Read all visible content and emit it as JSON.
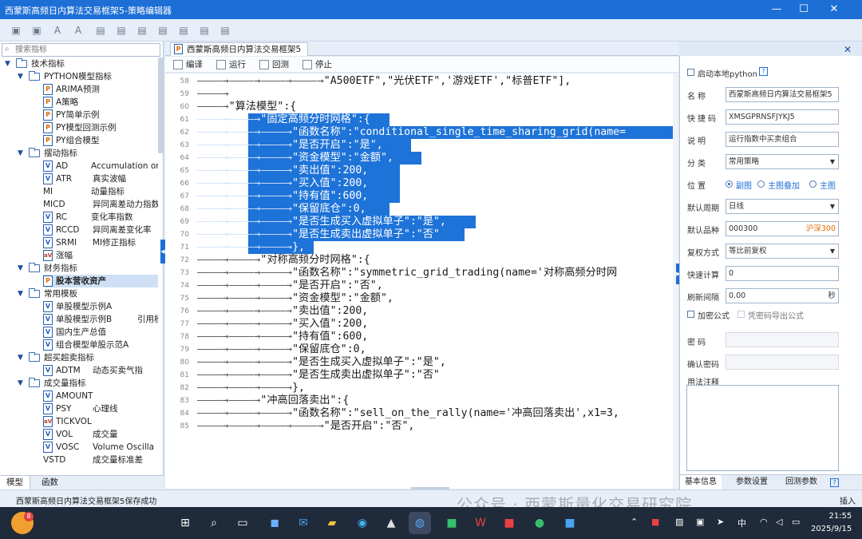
{
  "window": {
    "title": "西蒙斯高频日内算法交易框架5-策略编辑器",
    "minimize": "—",
    "maximize": "☐",
    "close": "✕"
  },
  "left": {
    "search_placeholder": "搜索指标",
    "tree": [
      {
        "kind": "folder",
        "level": 0,
        "label": "技术指标"
      },
      {
        "kind": "folder",
        "level": 1,
        "label": "PYTHON模型指标"
      },
      {
        "kind": "leaf",
        "icon": "p",
        "name": "ARIMA预测",
        "desc": ""
      },
      {
        "kind": "leaf",
        "icon": "p",
        "name": "A策略",
        "desc": ""
      },
      {
        "kind": "leaf",
        "icon": "p",
        "name": "PY简单示例",
        "desc": ""
      },
      {
        "kind": "leaf",
        "icon": "p",
        "name": "PY模型回测示例",
        "desc": ""
      },
      {
        "kind": "leaf",
        "icon": "p",
        "name": "PY组合模型",
        "desc": ""
      },
      {
        "kind": "folder",
        "level": 1,
        "label": "摆动指标"
      },
      {
        "kind": "leaf",
        "icon": "v",
        "name": "AD",
        "desc": "Accumulation or"
      },
      {
        "kind": "leaf",
        "icon": "v",
        "name": "ATR",
        "desc": "真实波幅"
      },
      {
        "kind": "leaf",
        "icon": "",
        "name": "MI",
        "desc": "动量指标"
      },
      {
        "kind": "leaf",
        "icon": "",
        "name": "MICD",
        "desc": "异同离差动力指数"
      },
      {
        "kind": "leaf",
        "icon": "v",
        "name": "RC",
        "desc": "变化率指数"
      },
      {
        "kind": "leaf",
        "icon": "v",
        "name": "RCCD",
        "desc": "异同离差变化率"
      },
      {
        "kind": "leaf",
        "icon": "v",
        "name": "SRMI",
        "desc": "MI修正指标"
      },
      {
        "kind": "leaf",
        "icon": "av",
        "name": "涨幅",
        "desc": ""
      },
      {
        "kind": "folder",
        "level": 1,
        "label": "财务指标"
      },
      {
        "kind": "leaf",
        "icon": "p",
        "name": "股本营收资产",
        "desc": "",
        "selected": true
      },
      {
        "kind": "folder",
        "level": 1,
        "label": "常用模板"
      },
      {
        "kind": "leaf",
        "icon": "v",
        "name": "单股模型示例A",
        "desc": ""
      },
      {
        "kind": "leaf",
        "icon": "v",
        "name": "单股模型示例B",
        "desc": "引用模"
      },
      {
        "kind": "leaf",
        "icon": "v",
        "name": "国内生产总值",
        "desc": ""
      },
      {
        "kind": "leaf",
        "icon": "v",
        "name": "组合模型单股示范A",
        "desc": ""
      },
      {
        "kind": "folder",
        "level": 1,
        "label": "超买超卖指标"
      },
      {
        "kind": "leaf",
        "icon": "v",
        "name": "ADTM",
        "desc": "动态买卖气指"
      },
      {
        "kind": "folder",
        "level": 1,
        "label": "成交量指标"
      },
      {
        "kind": "leaf",
        "icon": "v",
        "name": "AMOUNT",
        "desc": ""
      },
      {
        "kind": "leaf",
        "icon": "v",
        "name": "PSY",
        "desc": "心理线"
      },
      {
        "kind": "leaf",
        "icon": "av",
        "name": "TICKVOL",
        "desc": ""
      },
      {
        "kind": "leaf",
        "icon": "v",
        "name": "VOL",
        "desc": "成交量"
      },
      {
        "kind": "leaf",
        "icon": "v",
        "name": "VOSC",
        "desc": "Volume Oscilla"
      },
      {
        "kind": "leaf",
        "icon": "",
        "name": "VSTD",
        "desc": "成交量标准差"
      }
    ],
    "tabs": [
      "模型",
      "函数"
    ]
  },
  "editor": {
    "tab_title": "西蒙斯高频日内算法交易框架5",
    "toolbar": [
      "编译",
      "运行",
      "回测",
      "停止"
    ],
    "lines": [
      {
        "n": "58",
        "indent": "————→————→————→————→",
        "text": "\"A500ETF\",\"光伏ETF\",'游戏ETF',\"标普ETF\"],",
        "sel": false
      },
      {
        "n": "59",
        "indent": "————→",
        "text": "",
        "sel": false
      },
      {
        "n": "60",
        "indent": "————→",
        "text": "\"算法模型\":{",
        "sel": false
      },
      {
        "n": "61",
        "indent": "————→————→",
        "text": "\"固定高频分时网格\":{",
        "sel": true
      },
      {
        "n": "62",
        "indent": "————→————→————→",
        "text": "\"函数名称\":\"conditional_single_time_sharing_grid(name=",
        "sel": true
      },
      {
        "n": "63",
        "indent": "————→————→————→",
        "text": "\"是否开启\":\"是\",",
        "sel": true
      },
      {
        "n": "64",
        "indent": "————→————→————→",
        "text": "\"资金模型\":\"金额\",",
        "sel": true
      },
      {
        "n": "65",
        "indent": "————→————→————→",
        "text": "\"卖出值\":200,",
        "sel": true
      },
      {
        "n": "66",
        "indent": "————→————→————→",
        "text": "\"买入值\":200,",
        "sel": true
      },
      {
        "n": "67",
        "indent": "————→————→————→",
        "text": "\"持有值\":600,",
        "sel": true
      },
      {
        "n": "68",
        "indent": "————→————→————→",
        "text": "\"保留底仓\":0,",
        "sel": true
      },
      {
        "n": "69",
        "indent": "————→————→————→",
        "text": "\"是否生成买入虚拟单子\":\"是\",",
        "sel": true
      },
      {
        "n": "70",
        "indent": "————→————→————→",
        "text": "\"是否生成卖出虚拟单子\":\"否\"",
        "sel": true
      },
      {
        "n": "71",
        "indent": "————→————→————→",
        "text": "},",
        "sel": true
      },
      {
        "n": "72",
        "indent": "————→————→",
        "text": "\"对称高频分时网格\":{",
        "sel": false
      },
      {
        "n": "73",
        "indent": "————→————→————→",
        "text": "\"函数名称\":\"symmetric_grid_trading(name='对称高频分时网",
        "sel": false
      },
      {
        "n": "74",
        "indent": "————→————→————→",
        "text": "\"是否开启\":\"否\",",
        "sel": false
      },
      {
        "n": "75",
        "indent": "————→————→————→",
        "text": "\"资金模型\":\"金额\",",
        "sel": false
      },
      {
        "n": "76",
        "indent": "————→————→————→",
        "text": "\"卖出值\":200,",
        "sel": false
      },
      {
        "n": "77",
        "indent": "————→————→————→",
        "text": "\"买入值\":200,",
        "sel": false
      },
      {
        "n": "78",
        "indent": "————→————→————→",
        "text": "\"持有值\":600,",
        "sel": false
      },
      {
        "n": "79",
        "indent": "————→————→————→",
        "text": "\"保留底仓\":0,",
        "sel": false
      },
      {
        "n": "80",
        "indent": "————→————→————→",
        "text": "\"是否生成买入虚拟单子\":\"是\",",
        "sel": false
      },
      {
        "n": "81",
        "indent": "————→————→————→",
        "text": "\"是否生成卖出虚拟单子\":\"否\"",
        "sel": false
      },
      {
        "n": "82",
        "indent": "————→————→————→",
        "text": "},",
        "sel": false
      },
      {
        "n": "83",
        "indent": "————→————→",
        "text": "\"冲高回落卖出\":{",
        "sel": false
      },
      {
        "n": "84",
        "indent": "————→————→————→",
        "text": "\"函数名称\":\"sell_on_the_rally(name='冲高回落卖出',x1=3,",
        "sel": false
      },
      {
        "n": "85",
        "indent": "————→————→————→————→",
        "text": "\"是否开启\":\"否\",",
        "sel": false
      }
    ]
  },
  "right": {
    "enable_local_python": "启动本地python",
    "help": "?",
    "name_label": "名称",
    "name_value": "西蒙斯高频日内算法交易框架5",
    "code_label": "快捷码",
    "code_value": "XMSGPRNSFJYKJ5",
    "desc_label": "说明",
    "desc_value": "运行指数中买卖组合",
    "category_label": "分类",
    "category_value": "常用策略",
    "position_label": "位置",
    "position_options": [
      "副图",
      "主图叠加",
      "主图"
    ],
    "period_label": "默认周期",
    "period_value": "日线",
    "symbol_label": "默认品种",
    "symbol_value": "000300",
    "symbol_hint": "沪深300",
    "adjust_label": "复权方式",
    "adjust_value": "等比前复权",
    "fastcalc_label": "快速计算",
    "fastcalc_value": "0",
    "refresh_label": "刷新间隔",
    "refresh_value": "0.00",
    "refresh_unit": "秒",
    "encrypt_label": "加密公式",
    "export_label": "凭密码导出公式",
    "pwd_label": "密码",
    "confirm_label": "确认密码",
    "notes_label": "用法注释",
    "tabs": [
      "基本信息",
      "参数设置",
      "回测参数"
    ],
    "hint_color": "#e06a00"
  },
  "status": {
    "message": "西蒙斯高频日内算法交易框架5保存成功",
    "mode": "插入"
  },
  "watermark": "公众号 · 西蒙斯量化交易研究院",
  "taskbar": {
    "badge": "8",
    "tray_lang": "中",
    "time": "21:55",
    "date": "2025/9/15"
  },
  "colors": {
    "accent": "#1d6fd6",
    "selection": "#1e73d8"
  }
}
